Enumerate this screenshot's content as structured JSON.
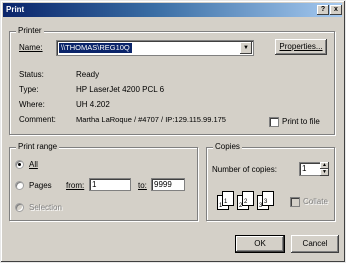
{
  "title": "Print",
  "title_buttons": {
    "help": "?",
    "close": "x"
  },
  "printer": {
    "group_label": "Printer",
    "name_label": "Name:",
    "name_value": "\\\\THOMAS\\REG10Q",
    "properties_button": "Properties...",
    "status_label": "Status:",
    "status_value": "Ready",
    "type_label": "Type:",
    "type_value": "HP LaserJet 4200 PCL 6",
    "where_label": "Where:",
    "where_value": "UH 4.202",
    "comment_label": "Comment:",
    "comment_value": "Martha LaRoque / #4707 / IP:129.115.99.175",
    "print_to_file_label": "Print to file"
  },
  "print_range": {
    "group_label": "Print range",
    "all_label": "All",
    "pages_label": "Pages",
    "from_label": "from:",
    "from_value": "1",
    "to_label": "to:",
    "to_value": "9999",
    "selection_label": "Selection"
  },
  "copies": {
    "group_label": "Copies",
    "number_label": "Number of copies:",
    "number_value": "1",
    "collate_label": "Collate",
    "pages": [
      "1",
      "1",
      "2",
      "2",
      "3",
      "3"
    ]
  },
  "buttons": {
    "ok": "OK",
    "cancel": "Cancel"
  }
}
